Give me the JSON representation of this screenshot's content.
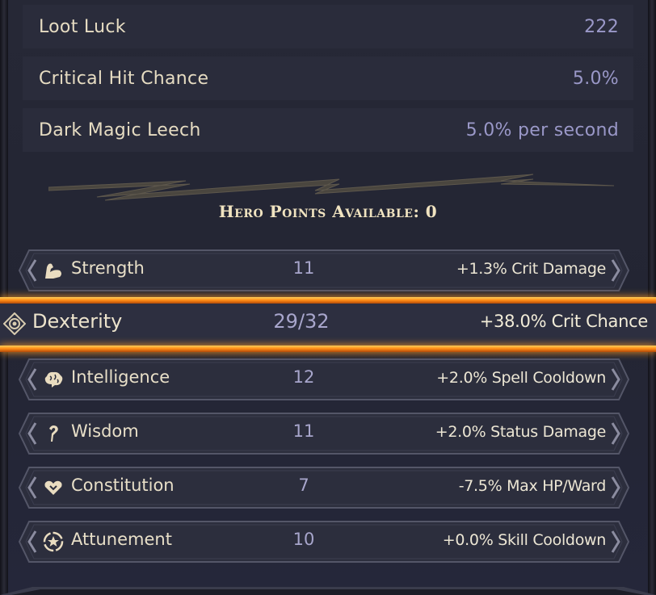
{
  "stats": [
    {
      "label": "Loot Luck",
      "value": "222"
    },
    {
      "label": "Critical Hit Chance",
      "value": "5.0%"
    },
    {
      "label": "Dark Magic Leech",
      "value": "5.0% per second"
    }
  ],
  "hero_points": {
    "label": "Hero Points Available: 0"
  },
  "attributes": [
    {
      "name": "Strength",
      "value": "11",
      "bonus": "+1.3% Crit Damage",
      "icon": "flexed-arm-icon"
    },
    {
      "name": "Dexterity",
      "value": "29/32",
      "bonus": "+38.0% Crit Chance",
      "icon": "target-eye-icon"
    },
    {
      "name": "Intelligence",
      "value": "12",
      "bonus": "+2.0% Spell Cooldown",
      "icon": "brain-icon"
    },
    {
      "name": "Wisdom",
      "value": "11",
      "bonus": "+2.0% Status Damage",
      "icon": "mystic-rune-icon"
    },
    {
      "name": "Constitution",
      "value": "7",
      "bonus": "-7.5% Max HP/Ward",
      "icon": "heart-shield-icon"
    },
    {
      "name": "Attunement",
      "value": "10",
      "bonus": "+0.0% Skill Cooldown",
      "icon": "star-circle-icon"
    }
  ],
  "colors": {
    "background": "#1b1c27",
    "label_text": "#e6dcc2",
    "value_text": "#9a98c8",
    "selection_glow": "#ff9a20"
  }
}
